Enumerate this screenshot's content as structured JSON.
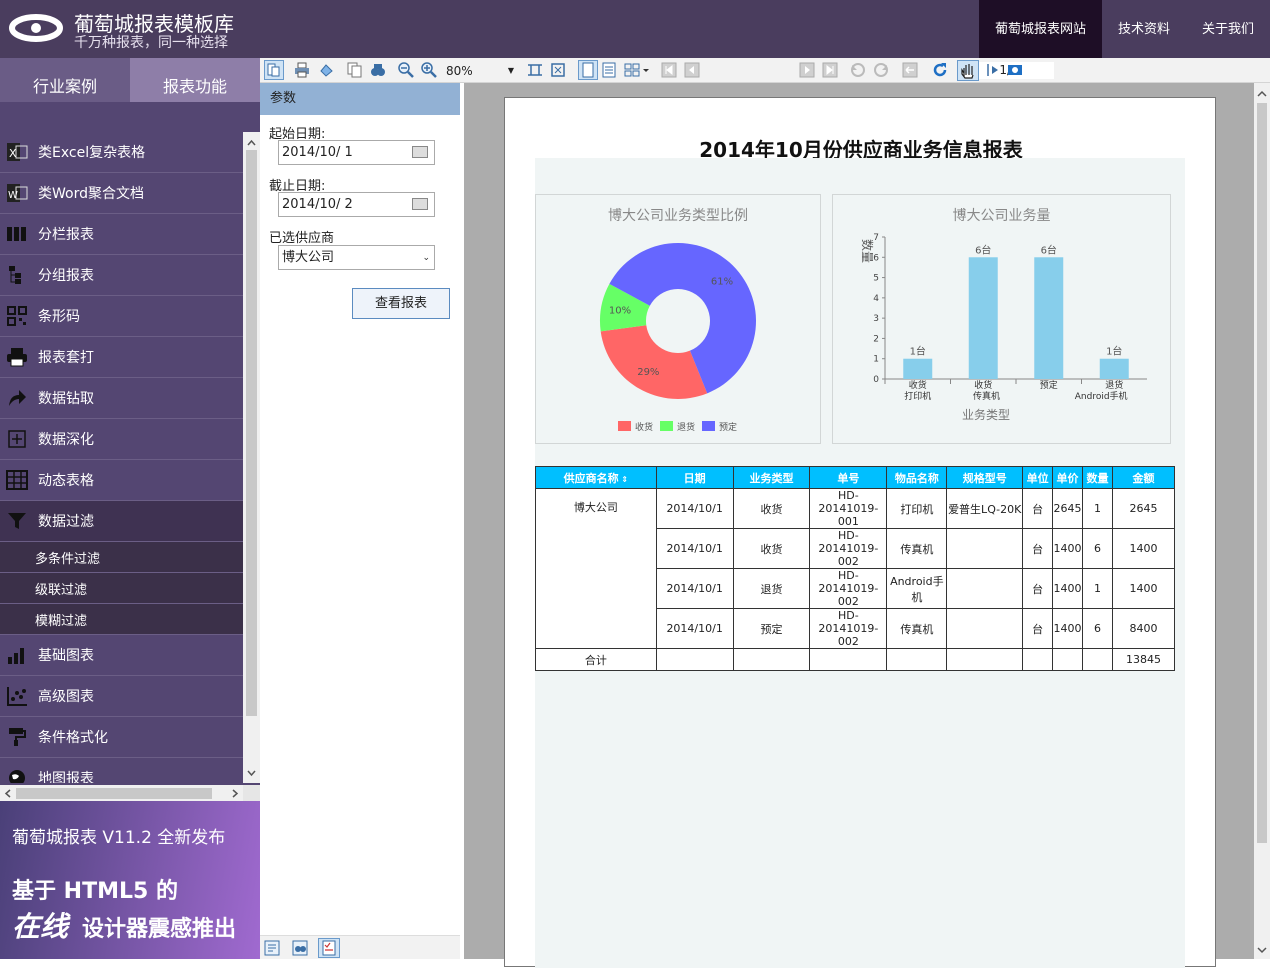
{
  "header": {
    "brand_title": "葡萄城报表模板库",
    "brand_subtitle": "千万种报表，同一种选择",
    "nav": [
      {
        "label": "葡萄城报表网站"
      },
      {
        "label": "技术资料"
      },
      {
        "label": "关于我们"
      }
    ]
  },
  "sidebar": {
    "tabs": [
      {
        "label": "行业案例"
      },
      {
        "label": "报表功能"
      }
    ],
    "items": [
      {
        "label": "类Excel复杂表格",
        "icon": "excel-icon"
      },
      {
        "label": "类Word聚合文档",
        "icon": "word-icon"
      },
      {
        "label": "分栏报表",
        "icon": "columns-icon"
      },
      {
        "label": "分组报表",
        "icon": "group-icon"
      },
      {
        "label": "条形码",
        "icon": "barcode-icon"
      },
      {
        "label": "报表套打",
        "icon": "printer-icon"
      },
      {
        "label": "数据钻取",
        "icon": "drill-arrow-icon"
      },
      {
        "label": "数据深化",
        "icon": "plus-box-icon"
      },
      {
        "label": "动态表格",
        "icon": "table-icon"
      },
      {
        "label": "数据过滤",
        "icon": "filter-icon"
      }
    ],
    "subitems": [
      {
        "label": "多条件过滤"
      },
      {
        "label": "级联过滤"
      },
      {
        "label": "模糊过滤"
      }
    ],
    "items2": [
      {
        "label": "基础图表",
        "icon": "bar-chart-icon"
      },
      {
        "label": "高级图表",
        "icon": "scatter-chart-icon"
      },
      {
        "label": "条件格式化",
        "icon": "paint-roller-icon"
      },
      {
        "label": "地图报表",
        "icon": "globe-icon"
      }
    ]
  },
  "promo": {
    "line1": "葡萄城报表 V11.2 全新发布",
    "line2": "基于 HTML5 的",
    "line3a": "在线",
    "line3b": "设计器震感推出"
  },
  "toolbar": {
    "zoom": "80%",
    "page": "1/1"
  },
  "params": {
    "header": "参数",
    "start_label": "起始日期:",
    "start_value": "2014/10/  1",
    "end_label": "截止日期:",
    "end_value": "2014/10/  2",
    "supplier_label": "已选供应商",
    "supplier_value": "博大公司",
    "submit": "查看报表"
  },
  "report": {
    "title": "2014年10月份供应商业务信息报表",
    "columns": [
      "供应商名称",
      "日期",
      "业务类型",
      "单号",
      "物品名称",
      "规格型号",
      "单位",
      "单价",
      "数量",
      "金额"
    ],
    "supplier": "博大公司",
    "rows": [
      {
        "date": "2014/10/1",
        "type": "收货",
        "no": "HD-20141019-001",
        "item": "打印机",
        "spec": "爱普生LQ-20K",
        "unit": "台",
        "price": "2645",
        "qty": "1",
        "amount": "2645"
      },
      {
        "date": "2014/10/1",
        "type": "收货",
        "no": "HD-20141019-002",
        "item": "传真机",
        "spec": "",
        "unit": "台",
        "price": "1400",
        "qty": "6",
        "amount": "1400"
      },
      {
        "date": "2014/10/1",
        "type": "退货",
        "no": "HD-20141019-002",
        "item": "Android手机",
        "spec": "",
        "unit": "台",
        "price": "1400",
        "qty": "1",
        "amount": "1400"
      },
      {
        "date": "2014/10/1",
        "type": "预定",
        "no": "HD-20141019-002",
        "item": "传真机",
        "spec": "",
        "unit": "台",
        "price": "1400",
        "qty": "6",
        "amount": "8400"
      }
    ],
    "total_label": "合计",
    "total_amount": "13845"
  },
  "chart_data": [
    {
      "type": "pie",
      "title": "博大公司业务类型比例",
      "categories": [
        "收货",
        "退货",
        "预定"
      ],
      "values": [
        29,
        10,
        61
      ],
      "data_labels": [
        "29%",
        "10%",
        "61%"
      ],
      "colors": [
        "#ff6666",
        "#66ff66",
        "#6666ff"
      ],
      "legend": "bottom"
    },
    {
      "type": "bar",
      "title": "博大公司业务量",
      "categories": [
        "收货打印机",
        "收货传真机",
        "预定",
        "退货Android手机"
      ],
      "tick_top": [
        "收货",
        "收货",
        "预定",
        "退货"
      ],
      "tick_bottom": [
        "打印机",
        "传真机",
        "",
        "Android手机"
      ],
      "values": [
        1,
        6,
        6,
        1
      ],
      "data_labels": [
        "1台",
        "6台",
        "6台",
        "1台"
      ],
      "ylabel": "数量",
      "xlabel": "业务类型",
      "ylim": [
        0,
        7
      ],
      "yticks": [
        "0",
        "1",
        "2",
        "3",
        "4",
        "5",
        "6",
        "7"
      ],
      "color": "#87ceeb",
      "grid": false
    }
  ]
}
